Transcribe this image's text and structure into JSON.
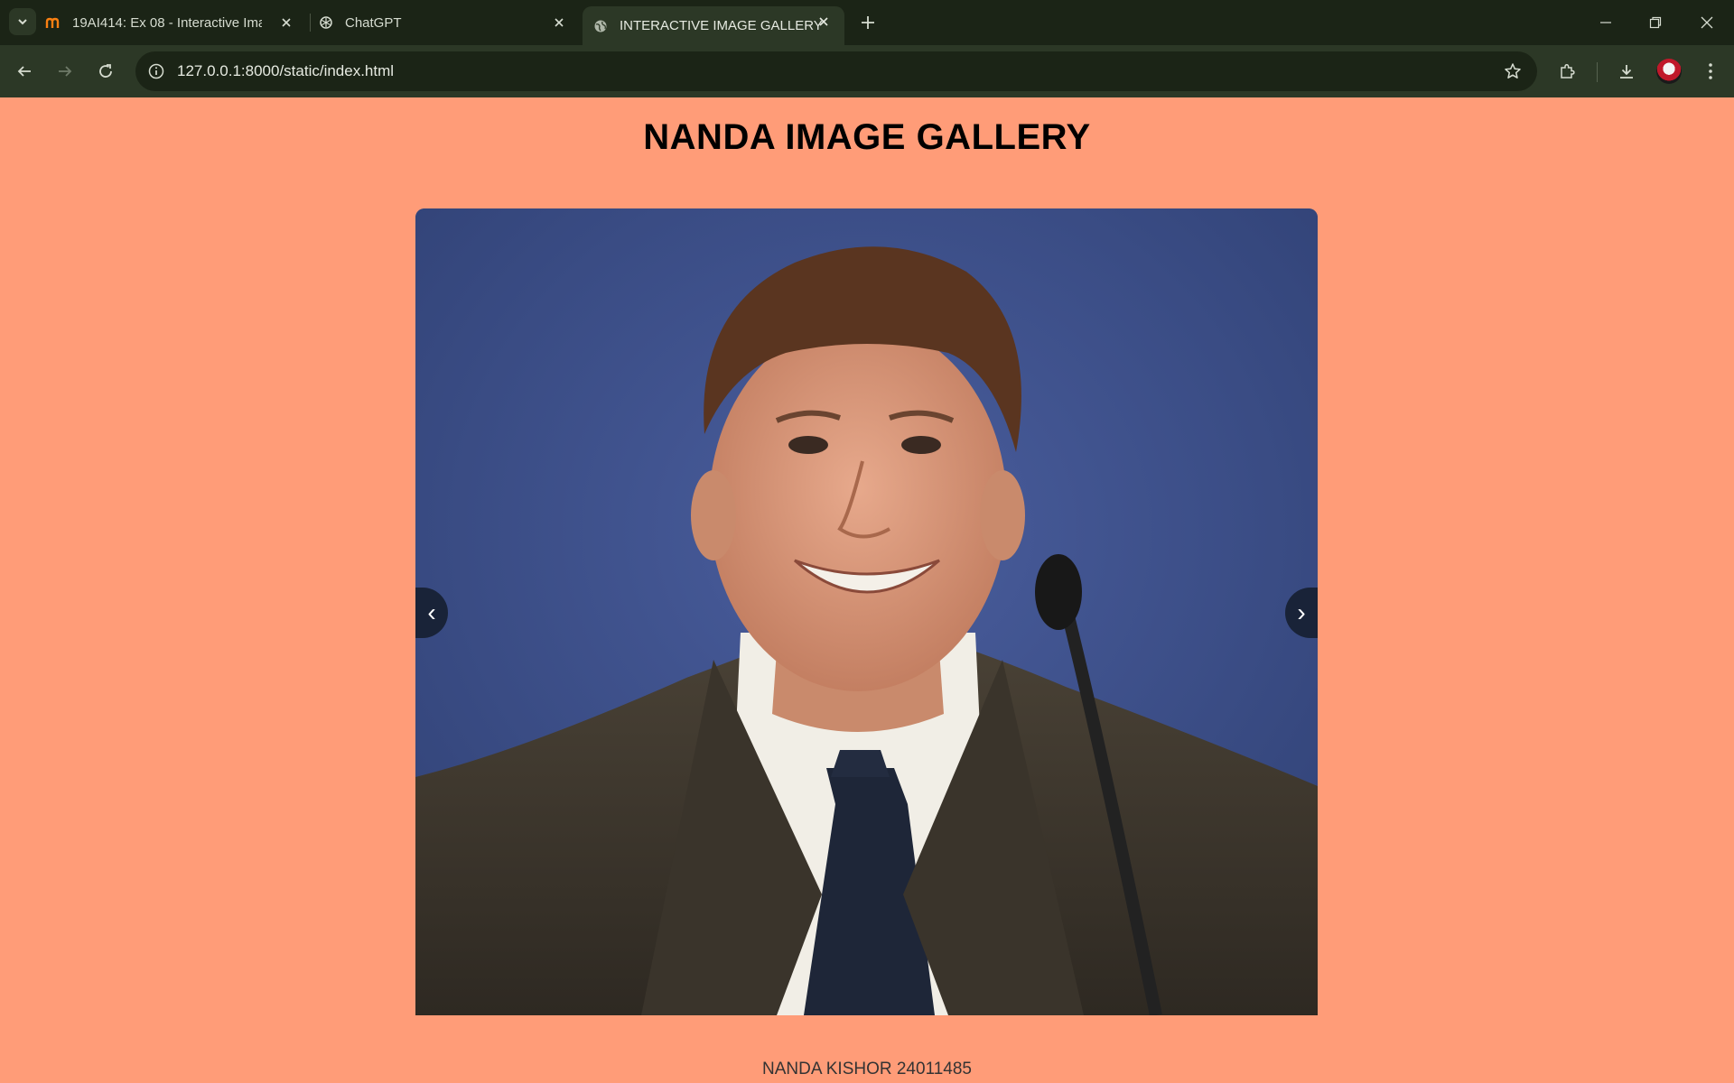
{
  "browser": {
    "tabs": [
      {
        "title": "19AI414: Ex 08 - Interactive Ima",
        "icon": "moodle-icon",
        "active": false
      },
      {
        "title": "ChatGPT",
        "icon": "chatgpt-icon",
        "active": false
      },
      {
        "title": "INTERACTIVE IMAGE GALLERY",
        "icon": "globe-icon",
        "active": true
      }
    ],
    "url": "127.0.0.1:8000/static/index.html"
  },
  "page": {
    "title": "NANDA IMAGE GALLERY",
    "prev_label": "‹",
    "next_label": "›",
    "footer": "NANDA KISHOR 24011485"
  },
  "colors": {
    "page_background": "#FF9C78",
    "browser_frame": "#1B2416",
    "browser_toolbar": "#2C3826"
  }
}
